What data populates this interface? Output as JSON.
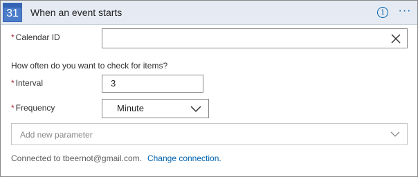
{
  "header": {
    "calendar_day": "31",
    "title": "When an event starts",
    "info_glyph": "i",
    "more_glyph": "···"
  },
  "fields": {
    "calendar_id": {
      "required_mark": "*",
      "label": "Calendar ID",
      "value": ""
    },
    "section_prompt": "How often do you want to check for items?",
    "interval": {
      "required_mark": "*",
      "label": "Interval",
      "value": "3"
    },
    "frequency": {
      "required_mark": "*",
      "label": "Frequency",
      "selected": "Minute"
    }
  },
  "add_parameter": {
    "placeholder": "Add new parameter"
  },
  "footer": {
    "connected_text": "Connected to tbeernot@gmail.com.",
    "change_link": "Change connection."
  },
  "colors": {
    "header_bg": "#e5eaf3",
    "accent": "#0062ad",
    "required": "#a4262c",
    "calendar_icon": "#4a7cc9"
  },
  "icons": {
    "calendar": "google-calendar-icon",
    "info": "info-icon",
    "more": "more-options-icon",
    "clear": "close-icon",
    "dropdown": "chevron-down-icon"
  }
}
